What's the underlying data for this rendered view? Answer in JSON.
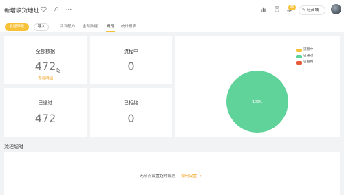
{
  "header": {
    "title": "新增收货地址",
    "icons": [
      "heart-icon",
      "pin-icon",
      "more-icon",
      "chart-icon",
      "document-icon",
      "bell-icon"
    ],
    "notification_count": "99",
    "shop_label": "轻商城"
  },
  "toolbar": {
    "primary_label": "发起审批",
    "import_label": "导入",
    "tabs": [
      {
        "label": "我发起的"
      },
      {
        "label": "全部数据"
      },
      {
        "label": "概览",
        "active": true
      },
      {
        "label": "统计报表"
      }
    ]
  },
  "stats": {
    "all": {
      "label": "全部数据",
      "value": "472",
      "link": "查看明细"
    },
    "in_progress": {
      "label": "流程中",
      "value": "0"
    },
    "approved": {
      "label": "已通过",
      "value": "472"
    },
    "rejected": {
      "label": "已拒绝",
      "value": "0"
    }
  },
  "chart_data": {
    "type": "pie",
    "categories": [
      "流程中",
      "已通过",
      "已拒绝"
    ],
    "values": [
      0,
      472,
      0
    ],
    "colors": [
      "#f7c23a",
      "#5fd39a",
      "#e65a3c"
    ],
    "slice_label": "100%",
    "legend_position": "top-right"
  },
  "timeout": {
    "section_title": "流程超时",
    "empty_text": "无节点设置超时规则",
    "empty_link": "如何设置 →"
  },
  "colors": {
    "accent": "#f7c23a",
    "approved_green": "#5fd39a",
    "rejected_red": "#e65a3c",
    "link_orange": "#f0a020"
  }
}
